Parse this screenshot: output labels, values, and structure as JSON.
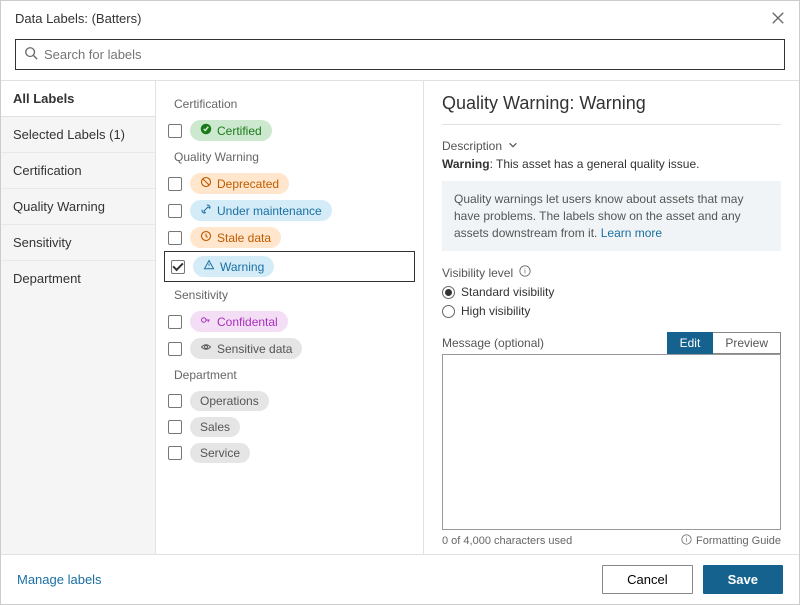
{
  "titlebar": {
    "title": "Data Labels: (Batters)"
  },
  "search": {
    "placeholder": "Search for labels"
  },
  "sidebar": {
    "header": "All Labels",
    "items": [
      {
        "label": "Selected Labels (1)"
      },
      {
        "label": "Certification"
      },
      {
        "label": "Quality Warning"
      },
      {
        "label": "Sensitivity"
      },
      {
        "label": "Department"
      }
    ]
  },
  "sections": {
    "certification": {
      "title": "Certification",
      "items": [
        {
          "label": "Certified"
        }
      ]
    },
    "quality": {
      "title": "Quality Warning",
      "items": [
        {
          "label": "Deprecated"
        },
        {
          "label": "Under maintenance"
        },
        {
          "label": "Stale data"
        },
        {
          "label": "Warning"
        }
      ]
    },
    "sensitivity": {
      "title": "Sensitivity",
      "items": [
        {
          "label": "Confidental"
        },
        {
          "label": "Sensitive data"
        }
      ]
    },
    "department": {
      "title": "Department",
      "items": [
        {
          "label": "Operations"
        },
        {
          "label": "Sales"
        },
        {
          "label": "Service"
        }
      ]
    }
  },
  "detail": {
    "title": "Quality Warning: Warning",
    "description_head": "Description",
    "description_label": "Warning",
    "description_text": ": This asset has a general quality issue.",
    "info_text": "Quality warnings let users know about assets that may have problems. The labels show on the asset and any assets downstream from it. ",
    "learn_more": "Learn more",
    "visibility_title": "Visibility level",
    "visibility_opts": [
      "Standard visibility",
      "High visibility"
    ],
    "message_title": "Message (optional)",
    "tabs": {
      "edit": "Edit",
      "preview": "Preview"
    },
    "char_count": "0 of 4,000 characters used",
    "formatting_guide": "Formatting Guide"
  },
  "footer": {
    "manage": "Manage labels",
    "cancel": "Cancel",
    "save": "Save"
  }
}
